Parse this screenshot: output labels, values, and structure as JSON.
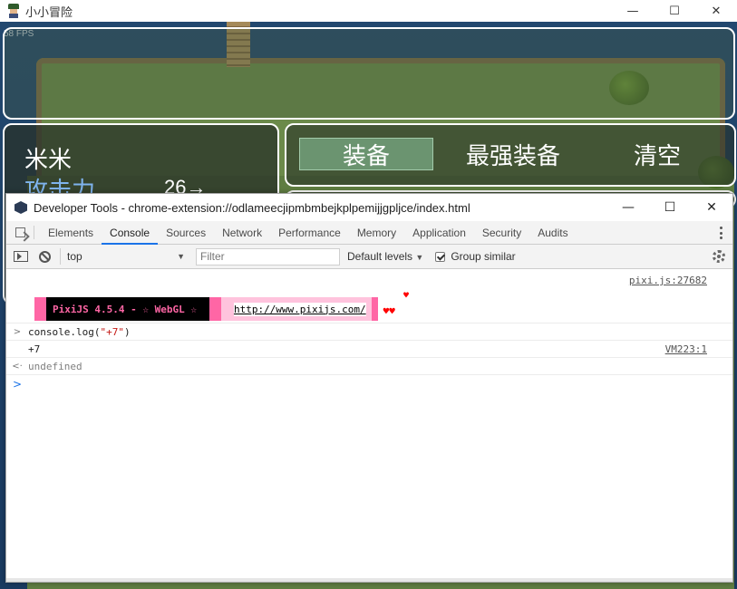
{
  "app": {
    "title": "小小冒险",
    "minimize": "—",
    "maximize": "☐",
    "close": "✕"
  },
  "game": {
    "fps": "58 FPS",
    "status": {
      "name": "米米",
      "attack_label": "攻击力",
      "attack_value": "26→"
    },
    "commands": {
      "equip": "装备",
      "best_equip": "最强装备",
      "clear": "清空"
    }
  },
  "devtools": {
    "title": "Developer Tools - chrome-extension://odlameecjipmbmbejkplpemijjgpljce/index.html",
    "controls": {
      "minimize": "—",
      "maximize": "☐",
      "close": "✕"
    },
    "tabs": [
      "Elements",
      "Console",
      "Sources",
      "Network",
      "Performance",
      "Memory",
      "Application",
      "Security",
      "Audits"
    ],
    "active_tab": "Console",
    "toolbar": {
      "context": "top",
      "filter_placeholder": "Filter",
      "levels": "Default levels",
      "group_similar": "Group similar"
    },
    "console": {
      "banner_source": "pixi.js:27682",
      "banner_text": "PixiJS 4.5.4 - ☆ WebGL ☆",
      "banner_url": "http://www.pixijs.com/",
      "banner_hearts": "♥♥",
      "banner_heart_top": "♥",
      "command_prefix": "console.log(",
      "command_arg": "\"+7\"",
      "command_suffix": ")",
      "output": "+7",
      "output_source": "VM223:1",
      "result": "undefined"
    }
  }
}
